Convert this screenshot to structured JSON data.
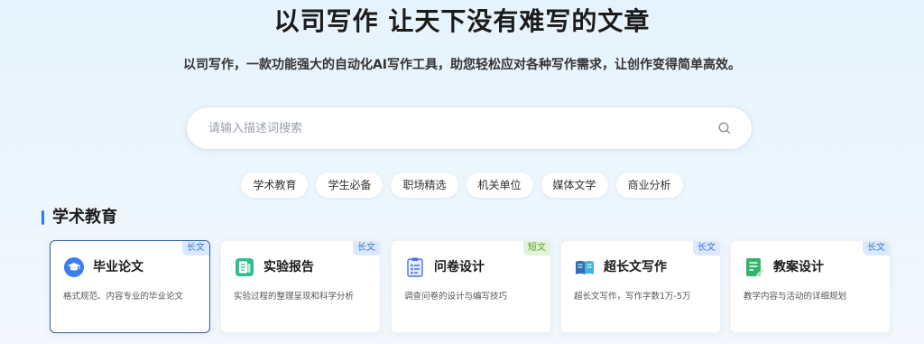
{
  "hero": {
    "title": "以司写作 让天下没有难写的文章",
    "subtitle": "以司写作，一款功能强大的自动化AI写作工具，助您轻松应对各种写作需求，让创作变得简单高效。"
  },
  "search": {
    "placeholder": "请输入描述词搜索",
    "value": "",
    "icon": "search-icon"
  },
  "tags": [
    "学术教育",
    "学生必备",
    "职场精选",
    "机关单位",
    "媒体文学",
    "商业分析"
  ],
  "section": {
    "title": "学术教育",
    "accent_color": "#2f7bf5"
  },
  "cards": [
    {
      "title": "毕业论文",
      "badge": "长文",
      "badge_color": "blue",
      "desc": "格式规范、内容专业的毕业论文",
      "icon": "graduation-cap-icon",
      "selected": true
    },
    {
      "title": "实验报告",
      "badge": "长文",
      "badge_color": "blue",
      "desc": "实验过程的整理呈现和科学分析",
      "icon": "report-icon",
      "selected": false
    },
    {
      "title": "问卷设计",
      "badge": "短文",
      "badge_color": "green",
      "desc": "调查问卷的设计与编写技巧",
      "icon": "questionnaire-icon",
      "selected": false
    },
    {
      "title": "超长文写作",
      "badge": "长文",
      "badge_color": "blue",
      "desc": "超长文写作，写作字数1万-5万",
      "icon": "open-book-icon",
      "selected": false
    },
    {
      "title": "教案设计",
      "badge": "长文",
      "badge_color": "blue",
      "desc": "教学内容与活动的详细规划",
      "icon": "lesson-plan-icon",
      "selected": false
    }
  ]
}
